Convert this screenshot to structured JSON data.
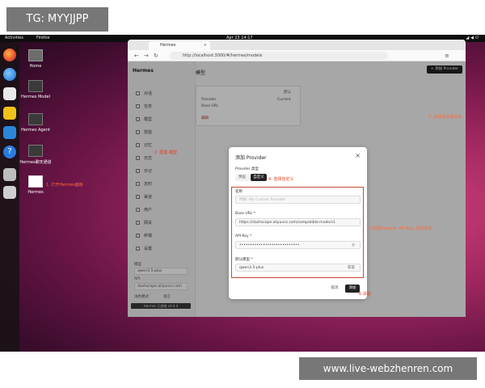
{
  "watermarks": {
    "top_left": "TG: MYYJJPP",
    "bottom_right": "www.live-webzhenren.com"
  },
  "topbar": {
    "activities": "Activities",
    "app": "Firefox",
    "clock": "Apr 23  14:17",
    "tray_icons": [
      "network-icon",
      "volume-icon",
      "power-icon"
    ]
  },
  "dock_icons": [
    "firefox-icon",
    "thunderbird-icon",
    "files-icon",
    "rhythmbox-icon",
    "writer-icon",
    "help-icon",
    "disk-icon",
    "trash-icon"
  ],
  "desktop_items": [
    {
      "label": "Home",
      "kind": "folder"
    },
    {
      "label": "Hermes Model",
      "kind": "terminal"
    },
    {
      "label": "Hermes Agent",
      "kind": "terminal"
    },
    {
      "label": "Hermes聊天通道",
      "kind": "terminal"
    },
    {
      "label": "Hermes",
      "kind": "avatar"
    }
  ],
  "browser": {
    "tab_title": "Hermes",
    "tab_close": "×",
    "url": "http://localhost:3000/#/hermes/models"
  },
  "app": {
    "brand": "Hermes",
    "nav": [
      "对话",
      "任务",
      "模型",
      "技能",
      "记忆",
      "日志",
      "日记",
      "定时",
      "渠道",
      "用户",
      "网关",
      "终端",
      "设置"
    ],
    "sidebar_labels": {
      "model_label": "模型",
      "model_value": "qwen3.5-plus",
      "api_label": "API",
      "api_value": "dashscope.aliyuncs.com",
      "theme_label": "浅色模式",
      "lang_label": "语言"
    },
    "status_text": "Hermes 已就绪 v0.4.4",
    "page_title": "模型",
    "add_provider_button": "+ 添加 Provider",
    "provider_card": {
      "badge": "默认",
      "line1": "Provider",
      "line2": "Base URL",
      "value": "Current",
      "action": "编辑"
    }
  },
  "modal": {
    "title": "添加 Provider",
    "close": "×",
    "provider_type_label": "Provider 类型",
    "segments": [
      "预设",
      "自定义"
    ],
    "name_label": "名称",
    "name_placeholder": "例如: My Custom Provider",
    "base_url_label": "Base URL *",
    "base_url_value": "https://dashscope.aliyuncs.com/compatible-mode/v1",
    "api_key_label": "API Key *",
    "api_key_value": "••••••••••••••••••••••••••••",
    "api_key_toggle": "◎",
    "default_model_label": "默认模型 *",
    "default_model_value": "qwen3.5-plus",
    "fetch_label": "获取",
    "cancel": "取消",
    "add": "添加"
  },
  "annotations": {
    "step1": "1. 打开Hermes面板",
    "step2": "2. 配置·模型",
    "step3": "3. 添加更多服务商",
    "step4": "4. 选择自定义",
    "step5": "5.配置BaseUrl, API Key, 模型名称",
    "step6": "6.添加"
  },
  "colors": {
    "annotation": "#e0401e",
    "desktop_accent": "#a62a62",
    "primary_button": "#222222"
  }
}
